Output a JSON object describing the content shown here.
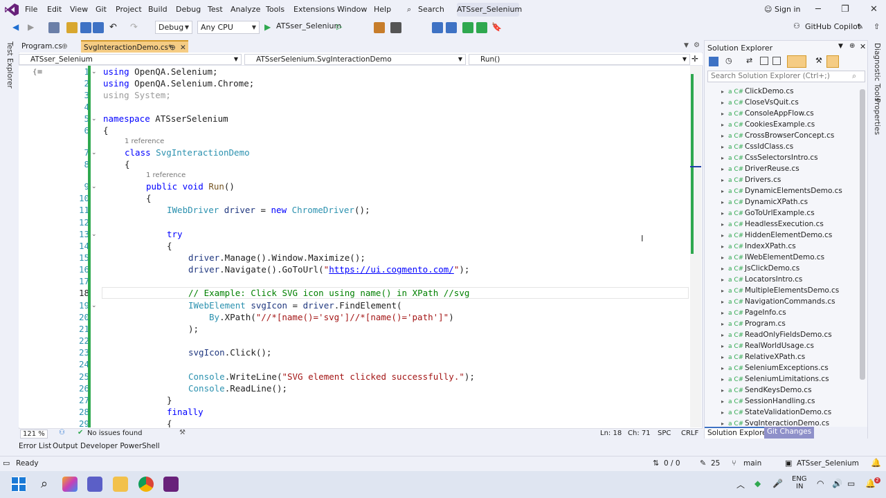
{
  "menu": {
    "items": [
      "File",
      "Edit",
      "View",
      "Git",
      "Project",
      "Build",
      "Debug",
      "Test",
      "Analyze",
      "Tools",
      "Extensions",
      "Window",
      "Help"
    ],
    "search": "Search",
    "solution_name": "ATSser_Selenium",
    "sign_in": "Sign in"
  },
  "toolbar": {
    "config": "Debug",
    "platform": "Any CPU",
    "start_project": "ATSser_Selenium",
    "copilot": "GitHub Copilot"
  },
  "left_strip": {
    "label": "Test Explorer"
  },
  "tabs": [
    {
      "label": "Program.cs",
      "pin": "⊕"
    },
    {
      "label": "SvgInteractionDemo.cs*",
      "pin": "⊕"
    }
  ],
  "navbar": {
    "project": "ATSser_Selenium",
    "class": "ATSserSelenium.SvgInteractionDemo",
    "member": "Run()"
  },
  "editor": {
    "lens1": "1 reference",
    "lens2": "1 reference",
    "line_numbers": [
      "1",
      "2",
      "3",
      "4",
      "5",
      "6",
      "7",
      "8",
      "9",
      "10",
      "11",
      "12",
      "13",
      "14",
      "15",
      "16",
      "17",
      "18",
      "19",
      "20",
      "21",
      "22",
      "23",
      "24",
      "25",
      "26",
      "27",
      "28",
      "29"
    ],
    "code": {
      "l1a": "using",
      "l1b": " OpenQA.Selenium;",
      "l2a": "using",
      "l2b": " OpenQA.Selenium.Chrome;",
      "l3": "using System;",
      "l5a": "namespace",
      "l5b": " ATSserSelenium",
      "l6": "{",
      "l7a": "class",
      "l7b": " SvgInteractionDemo",
      "l8": "{",
      "l9a": "public",
      "l9b": " void",
      "l9c": " Run",
      "l9d": "()",
      "l10": "{",
      "l11a": "IWebDriver",
      "l11b": " driver",
      "l11c": " = ",
      "l11d": "new",
      "l11e": " ChromeDriver",
      "l11f": "();",
      "l13": "try",
      "l14": "{",
      "l15a": "driver",
      ".l15b": "",
      "l15c": ".Manage().Window.Maximize();",
      "l16a": "driver",
      "l16b": ".Navigate().GoToUrl(",
      "l16c": "\"",
      "l16d": "https://ui.cogmento.com/",
      "l16e": "\"",
      "l16f": ");",
      "l18": "// Example: Click SVG icon using name() in XPath //svg",
      "l19a": "IWebElement",
      "l19b": " svgIcon",
      "l19c": " = ",
      "l19d": "driver",
      "l19e": ".FindElement(",
      "l20a": "By",
      "l20b": ".XPath(",
      "l20c": "\"//*[name()='svg']//*[name()='path']\"",
      "l20d": ")",
      "l21": ");",
      "l23a": "svgIcon",
      "l23b": ".Click();",
      "l25a": "Console",
      "l25b": ".WriteLine(",
      "l25c": "\"SVG element clicked successfully.\"",
      "l25d": ");",
      "l26a": "Console",
      "l26b": ".ReadLine();",
      "l27": "}",
      "l28": "finally",
      "l29": "{"
    },
    "zoom": "121 %",
    "issues": "No issues found",
    "line": "Ln: 18",
    "col": "Ch: 71",
    "spc": "SPC",
    "eol": "CRLF"
  },
  "solution_explorer": {
    "title": "Solution Explorer",
    "search_placeholder": "Search Solution Explorer (Ctrl+;)",
    "files": [
      "ClickDemo.cs",
      "CloseVsQuit.cs",
      "ConsoleAppFlow.cs",
      "CookiesExample.cs",
      "CrossBrowserConcept.cs",
      "CssIdClass.cs",
      "CssSelectorsIntro.cs",
      "DriverReuse.cs",
      "Drivers.cs",
      "DynamicElementsDemo.cs",
      "DynamicXPath.cs",
      "GoToUrlExample.cs",
      "HeadlessExecution.cs",
      "HiddenElementDemo.cs",
      "IndexXPath.cs",
      "IWebElementDemo.cs",
      "JsClickDemo.cs",
      "LocatorsIntro.cs",
      "MultipleElementsDemo.cs",
      "NavigationCommands.cs",
      "PageInfo.cs",
      "Program.cs",
      "ReadOnlyFieldsDemo.cs",
      "RealWorldUsage.cs",
      "RelativeXPath.cs",
      "SeleniumExceptions.cs",
      "SeleniumLimitations.cs",
      "SendKeysDemo.cs",
      "SessionHandling.cs",
      "StateValidationDemo.cs",
      "SvgInteractionDemo.cs"
    ],
    "tab_solution": "Solution Explorer",
    "tab_git": "Git Changes"
  },
  "right_strip": {
    "diag": "Diagnostic Tools",
    "props": "Properties"
  },
  "bottom_tabs": [
    "Error List",
    "Output",
    "Developer PowerShell"
  ],
  "status": {
    "ready": "Ready",
    "updown": "0 / 0",
    "edits": "25",
    "branch": "main",
    "repo": "ATSser_Selenium"
  },
  "taskbar": {
    "lang1": "ENG",
    "lang2": "IN",
    "badge": "2"
  },
  "colors": {
    "accent": "#68217a",
    "gutter_green": "#2fa84f",
    "keyword": "#0000ff",
    "type": "#2b91af",
    "string": "#a31515",
    "comment": "#008000"
  }
}
